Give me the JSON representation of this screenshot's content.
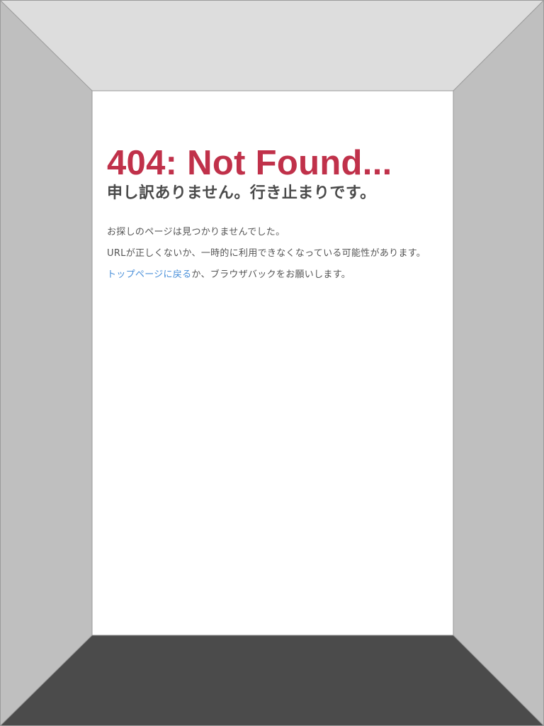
{
  "colors": {
    "ceiling": "#dddddd",
    "side_walls": "#bfbfbf",
    "floor": "#4b4b4b",
    "back_wall": "#ffffff",
    "edge": "#9a9a9a",
    "heading": "#c0314a",
    "subheading": "#4a4a4a",
    "body_text": "#555555",
    "link": "#4a90d9"
  },
  "error_page": {
    "heading": "404: Not Found...",
    "subheading": "申し訳ありません。行き止まりです。",
    "lines": [
      "お探しのページは見つかりませんでした。",
      "URLが正しくないか、一時的に利用できなくなっている可能性があります。"
    ],
    "link_text": "トップページに戻る",
    "after_link_text": "か、ブラウザバックをお願いします。"
  }
}
